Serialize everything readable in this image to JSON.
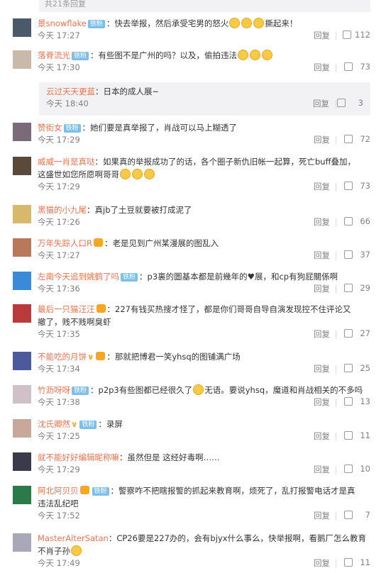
{
  "top_strip": {
    "text": "共21条回复"
  },
  "labels": {
    "reply": "回复"
  },
  "comments": [
    {
      "user": "景snowflake",
      "badge": "铁粉",
      "text": "：快去举报，然后承受宅男的怒火",
      "time": "今天 17:27",
      "likes": "112",
      "avatar_color": "#4a5a6a",
      "emoji_count": 3,
      "after": "撕起来！"
    },
    {
      "user": "落脊流光",
      "badge": "铁粉",
      "text": "：有些图不是广州的吗？以及，偷拍违法",
      "time": "今天 17:30",
      "likes": "73",
      "avatar_color": "#c9b9a8",
      "emoji_count": 3,
      "after": ""
    },
    {
      "user": "云过天天更蓝",
      "text": "：日本的成人展~",
      "time": "今天 18:40",
      "likes": "3",
      "nested": true
    },
    {
      "user": "赞街女",
      "badge": "铁粉",
      "text": "：她们要是真举报了，肖战可以马上糊透了",
      "time": "今天 17:29",
      "likes": "72",
      "avatar_color": "#7a6a7a"
    },
    {
      "user": "威威一肖是真哒",
      "text": "：如果真的举报成功了的话，各个圈子新仇旧帐一起算，死亡buff叠加，",
      "line2": "这盛世如您所愿啊哥哥",
      "time": "今天 17:29",
      "likes": "73",
      "avatar_color": "#5a4a3a",
      "emoji_count": 3
    },
    {
      "user": "黑猫的小九尾",
      "text": "：真jb了土豆就要被打成泥了",
      "time": "今天 17:26",
      "likes": "66",
      "avatar_color": "#d8b86a"
    },
    {
      "user": "万年失踪人口R",
      "vip": true,
      "text": "：老是见到广州某漫展的图乱入",
      "time": "今天 17:27",
      "likes": "37",
      "avatar_color": "#b8785a"
    },
    {
      "user": "左南今天追到姚鹤了吗",
      "badge": "铁粉",
      "text": "：p3裏的圖基本都是前幾年的",
      "heart_text": "展，和cp有狗屁關係啊",
      "time": "今天 17:36",
      "likes": "29",
      "avatar_color": "#3a8ad8"
    },
    {
      "user": "最后一只猫汪汪",
      "vip": true,
      "text": "：227有钱买热搜才怪了，都是你们哥哥自导自演发现控不住评论又",
      "line2": "撤了，贱不贱啊臭虾",
      "time": "今天 17:35",
      "likes": "27",
      "avatar_color": "#b83a3a"
    },
    {
      "user": "不能吃的月饼",
      "vipv": true,
      "vip": true,
      "text": "：那就把博君一笑yhsq的图铺满广场",
      "time": "今天 17:34",
      "likes": "25",
      "avatar_color": "#4a5a9a"
    },
    {
      "user": "竹沥呀呀",
      "badge": "铁粉",
      "text": "：p2p3有些图都已经很久了",
      "emoji_count": 1,
      "after": "无语。要说yhsq，魔道和肖战相关的不多吗",
      "time": "今天 17:38",
      "likes": "13",
      "avatar_color": "#d0c0c8"
    },
    {
      "user": "沈氏卿然",
      "vipv": true,
      "badge": "铁粉",
      "text": "：录屏",
      "time": "今天 17:25",
      "likes": "11",
      "avatar_color": "#c8a898"
    },
    {
      "user": "就不能好好编辑昵称嘛",
      "text": "：虽然但是 这经好毒啊……",
      "time": "今天 17:29",
      "likes": "10",
      "avatar_color": "#3a3a4a"
    },
    {
      "user": "阿北阿贝贝",
      "vip": true,
      "badge": "铁粉",
      "text": "：警察咋不把瞎报警的",
      "after": "抓起来教育啊，烦死了，乱打报警电话才是真",
      "line2": "违法乱纪吧",
      "time": "今天 17:52",
      "likes": "7",
      "avatar_color": "#2a7a4a"
    },
    {
      "user": "MasterAlterSatan",
      "text": "：CP26要是227办的，会有bjyx什么事么，快举报啊，看鹅厂怎么教育",
      "line2": "不肖子孙",
      "emoji_count": 1,
      "time": "今天 17:49",
      "likes": "11",
      "avatar_color": "#a8a8b8"
    }
  ]
}
